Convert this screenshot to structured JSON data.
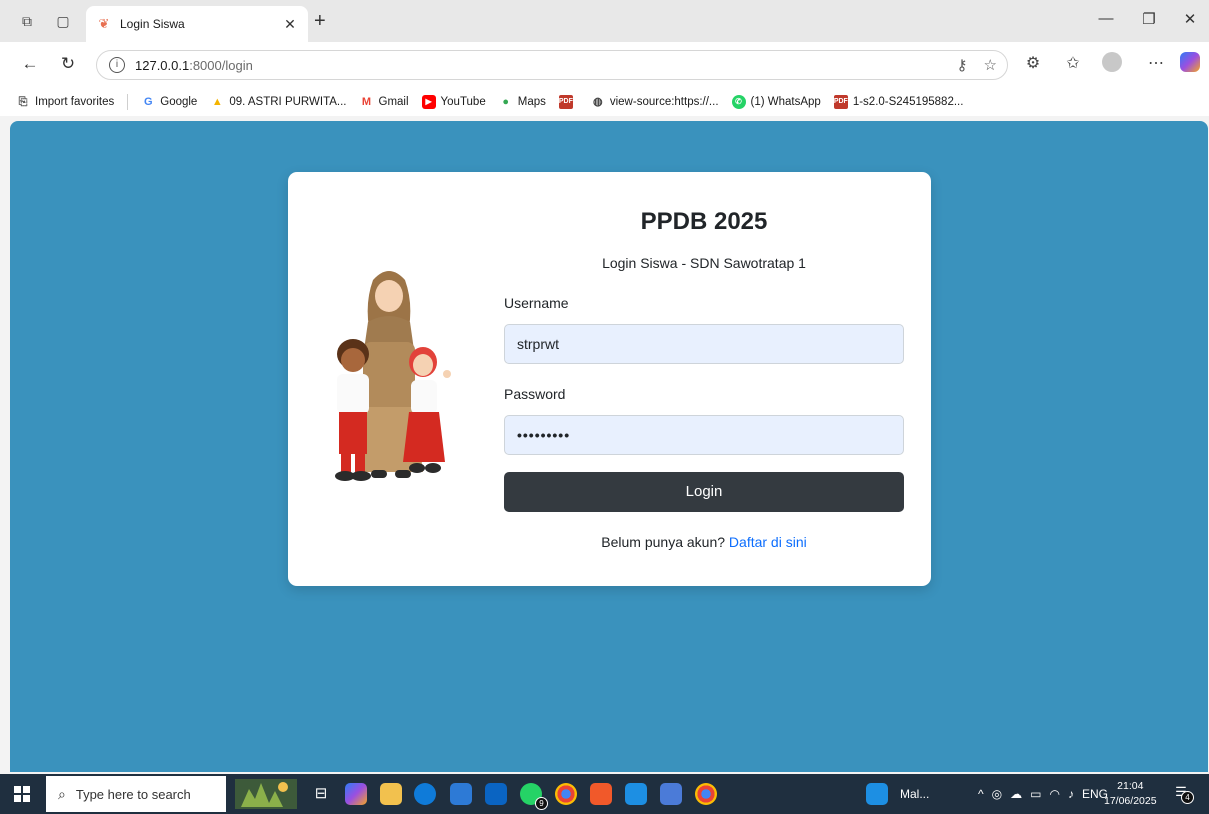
{
  "browser": {
    "tab_title": "Login Siswa",
    "url_host": "127.0.0.1",
    "url_path": ":8000/login",
    "favorites": [
      {
        "label": "Import favorites",
        "icon": "import-icon"
      },
      {
        "label": "Google",
        "icon": "google-icon"
      },
      {
        "label": "09. ASTRI PURWITA...",
        "icon": "drive-icon"
      },
      {
        "label": "Gmail",
        "icon": "gmail-icon"
      },
      {
        "label": "YouTube",
        "icon": "youtube-icon"
      },
      {
        "label": "Maps",
        "icon": "maps-icon"
      },
      {
        "label": "",
        "icon": "pdf-icon"
      },
      {
        "label": "view-source:https://...",
        "icon": "globe-icon"
      },
      {
        "label": "(1) WhatsApp",
        "icon": "whatsapp-icon"
      },
      {
        "label": "1-s2.0-S245195882...",
        "icon": "pdf-icon"
      }
    ]
  },
  "login": {
    "title": "PPDB 2025",
    "subtitle": "Login Siswa - SDN Sawotratap 1",
    "username_label": "Username",
    "username_value": "strprwt",
    "password_label": "Password",
    "password_value": "•••••••••",
    "button_label": "Login",
    "register_prompt": "Belum punya akun?",
    "register_link": "Daftar di sini"
  },
  "taskbar": {
    "search_placeholder": "Type here to search",
    "whatsapp_badge": "9",
    "mail_label": "Mal...",
    "language": "ENG",
    "time": "21:04",
    "date": "17/06/2025",
    "notifications": "4"
  },
  "colors": {
    "page_background": "#3a92bd",
    "button": "#343a40",
    "link": "#0d6efd"
  }
}
